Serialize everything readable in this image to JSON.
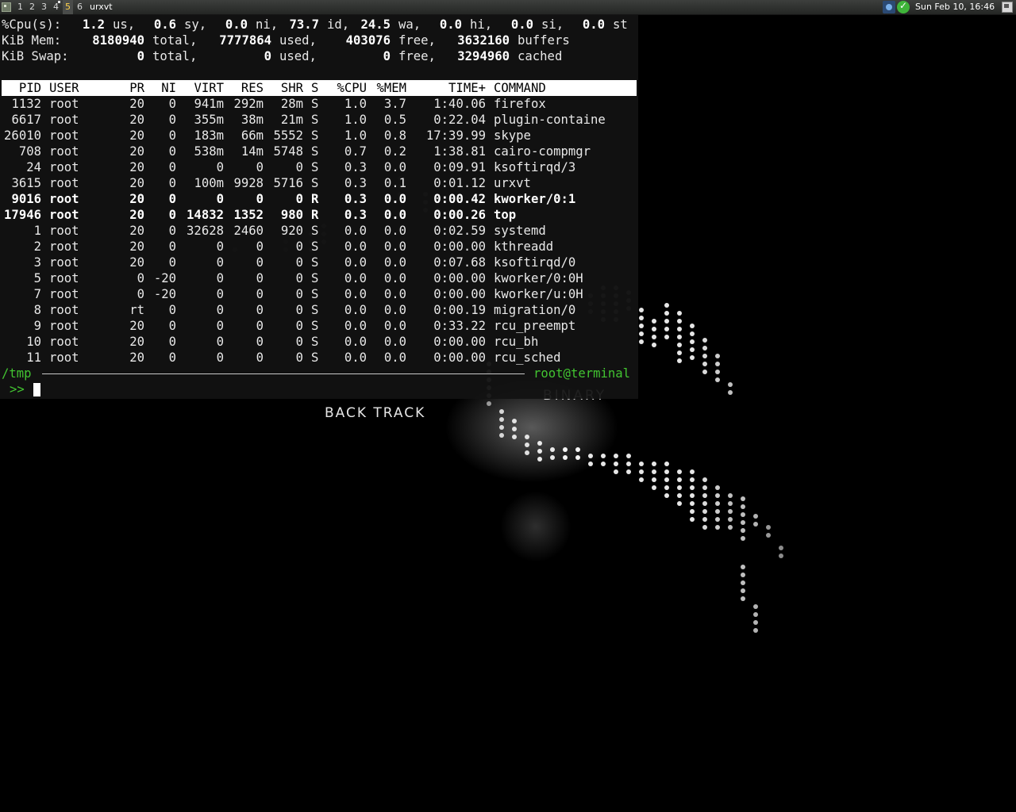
{
  "panel": {
    "workspaces": [
      "1",
      "2",
      "3",
      "4",
      "5",
      "6"
    ],
    "active_workspace": "5",
    "task_title": "urxvt",
    "clock": "Sun Feb 10, 16:46",
    "icons": {
      "menu": "menu-icon",
      "network": "network-icon",
      "update": "update-check-icon",
      "show_desktop": "show-desktop-icon"
    }
  },
  "wallpaper": {
    "backtrack_text": "BACK TRACK",
    "binary_text": "BINARY"
  },
  "top": {
    "cpu": {
      "label": "%Cpu(s):",
      "us": "1.2",
      "sy": "0.6",
      "ni": "0.0",
      "id": "73.7",
      "wa": "24.5",
      "hi": "0.0",
      "si": "0.0",
      "st": "0.0"
    },
    "mem": {
      "label": "KiB Mem:",
      "total": "8180940",
      "used": "7777864",
      "free": "403076",
      "buffers": "3632160"
    },
    "swap": {
      "label": "KiB Swap:",
      "total": "0",
      "used": "0",
      "free": "0",
      "cached": "3294960"
    },
    "columns": [
      "PID",
      "USER",
      "PR",
      "NI",
      "VIRT",
      "RES",
      "SHR",
      "S",
      "%CPU",
      "%MEM",
      "TIME+",
      "COMMAND"
    ],
    "processes": [
      {
        "pid": "1132",
        "user": "root",
        "pr": "20",
        "ni": "0",
        "virt": "941m",
        "res": "292m",
        "shr": "28m",
        "s": "S",
        "cpu": "1.0",
        "mem": "3.7",
        "time": "1:40.06",
        "command": "firefox",
        "bold": false
      },
      {
        "pid": "6617",
        "user": "root",
        "pr": "20",
        "ni": "0",
        "virt": "355m",
        "res": "38m",
        "shr": "21m",
        "s": "S",
        "cpu": "1.0",
        "mem": "0.5",
        "time": "0:22.04",
        "command": "plugin-containe",
        "bold": false
      },
      {
        "pid": "26010",
        "user": "root",
        "pr": "20",
        "ni": "0",
        "virt": "183m",
        "res": "66m",
        "shr": "5552",
        "s": "S",
        "cpu": "1.0",
        "mem": "0.8",
        "time": "17:39.99",
        "command": "skype",
        "bold": false
      },
      {
        "pid": "708",
        "user": "root",
        "pr": "20",
        "ni": "0",
        "virt": "538m",
        "res": "14m",
        "shr": "5748",
        "s": "S",
        "cpu": "0.7",
        "mem": "0.2",
        "time": "1:38.81",
        "command": "cairo-compmgr",
        "bold": false
      },
      {
        "pid": "24",
        "user": "root",
        "pr": "20",
        "ni": "0",
        "virt": "0",
        "res": "0",
        "shr": "0",
        "s": "S",
        "cpu": "0.3",
        "mem": "0.0",
        "time": "0:09.91",
        "command": "ksoftirqd/3",
        "bold": false
      },
      {
        "pid": "3615",
        "user": "root",
        "pr": "20",
        "ni": "0",
        "virt": "100m",
        "res": "9928",
        "shr": "5716",
        "s": "S",
        "cpu": "0.3",
        "mem": "0.1",
        "time": "0:01.12",
        "command": "urxvt",
        "bold": false
      },
      {
        "pid": "9016",
        "user": "root",
        "pr": "20",
        "ni": "0",
        "virt": "0",
        "res": "0",
        "shr": "0",
        "s": "R",
        "cpu": "0.3",
        "mem": "0.0",
        "time": "0:00.42",
        "command": "kworker/0:1",
        "bold": true
      },
      {
        "pid": "17946",
        "user": "root",
        "pr": "20",
        "ni": "0",
        "virt": "14832",
        "res": "1352",
        "shr": "980",
        "s": "R",
        "cpu": "0.3",
        "mem": "0.0",
        "time": "0:00.26",
        "command": "top",
        "bold": true
      },
      {
        "pid": "1",
        "user": "root",
        "pr": "20",
        "ni": "0",
        "virt": "32628",
        "res": "2460",
        "shr": "920",
        "s": "S",
        "cpu": "0.0",
        "mem": "0.0",
        "time": "0:02.59",
        "command": "systemd",
        "bold": false
      },
      {
        "pid": "2",
        "user": "root",
        "pr": "20",
        "ni": "0",
        "virt": "0",
        "res": "0",
        "shr": "0",
        "s": "S",
        "cpu": "0.0",
        "mem": "0.0",
        "time": "0:00.00",
        "command": "kthreadd",
        "bold": false
      },
      {
        "pid": "3",
        "user": "root",
        "pr": "20",
        "ni": "0",
        "virt": "0",
        "res": "0",
        "shr": "0",
        "s": "S",
        "cpu": "0.0",
        "mem": "0.0",
        "time": "0:07.68",
        "command": "ksoftirqd/0",
        "bold": false
      },
      {
        "pid": "5",
        "user": "root",
        "pr": "0",
        "ni": "-20",
        "virt": "0",
        "res": "0",
        "shr": "0",
        "s": "S",
        "cpu": "0.0",
        "mem": "0.0",
        "time": "0:00.00",
        "command": "kworker/0:0H",
        "bold": false
      },
      {
        "pid": "7",
        "user": "root",
        "pr": "0",
        "ni": "-20",
        "virt": "0",
        "res": "0",
        "shr": "0",
        "s": "S",
        "cpu": "0.0",
        "mem": "0.0",
        "time": "0:00.00",
        "command": "kworker/u:0H",
        "bold": false
      },
      {
        "pid": "8",
        "user": "root",
        "pr": "rt",
        "ni": "0",
        "virt": "0",
        "res": "0",
        "shr": "0",
        "s": "S",
        "cpu": "0.0",
        "mem": "0.0",
        "time": "0:00.19",
        "command": "migration/0",
        "bold": false
      },
      {
        "pid": "9",
        "user": "root",
        "pr": "20",
        "ni": "0",
        "virt": "0",
        "res": "0",
        "shr": "0",
        "s": "S",
        "cpu": "0.0",
        "mem": "0.0",
        "time": "0:33.22",
        "command": "rcu_preempt",
        "bold": false
      },
      {
        "pid": "10",
        "user": "root",
        "pr": "20",
        "ni": "0",
        "virt": "0",
        "res": "0",
        "shr": "0",
        "s": "S",
        "cpu": "0.0",
        "mem": "0.0",
        "time": "0:00.00",
        "command": "rcu_bh",
        "bold": false
      },
      {
        "pid": "11",
        "user": "root",
        "pr": "20",
        "ni": "0",
        "virt": "0",
        "res": "0",
        "shr": "0",
        "s": "S",
        "cpu": "0.0",
        "mem": "0.0",
        "time": "0:00.00",
        "command": "rcu_sched",
        "bold": false
      }
    ]
  },
  "shell": {
    "cwd": "/tmp",
    "host": "root@terminal",
    "prompt": ">>"
  },
  "colors": {
    "prompt_green": "#42c431",
    "terminal_bg": "#121212",
    "header_bg": "#ffffff"
  }
}
